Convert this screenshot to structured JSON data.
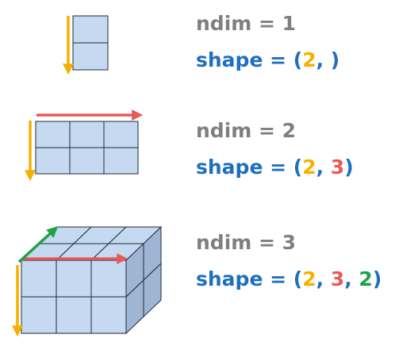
{
  "colors": {
    "cell_fill": "#c5d9f1",
    "cell_stroke": "#1f2a3a",
    "axis0_arrow": "#f5b000",
    "axis1_arrow": "#e85a5a",
    "axis2_arrow": "#21a04a",
    "ndim_text": "#7f7f7f",
    "shape_text": "#1f6fbf"
  },
  "arrays": [
    {
      "ndim_label": "ndim = 1",
      "shape_prefix": "shape = (",
      "dims": [
        "2"
      ],
      "separator": ", ",
      "trailing": ", ",
      "shape_suffix": ")",
      "arrows": [
        "axis0-arrow"
      ]
    },
    {
      "ndim_label": "ndim = 2",
      "shape_prefix": "shape = (",
      "dims": [
        "2",
        "3"
      ],
      "separator": ", ",
      "trailing": "",
      "shape_suffix": ")",
      "arrows": [
        "axis0-arrow",
        "axis1-arrow"
      ]
    },
    {
      "ndim_label": "ndim = 3",
      "shape_prefix": "shape = (",
      "dims": [
        "2",
        "3",
        "2"
      ],
      "separator": ", ",
      "trailing": "",
      "shape_suffix": ")",
      "arrows": [
        "axis0-arrow",
        "axis1-arrow",
        "axis2-arrow"
      ]
    }
  ]
}
